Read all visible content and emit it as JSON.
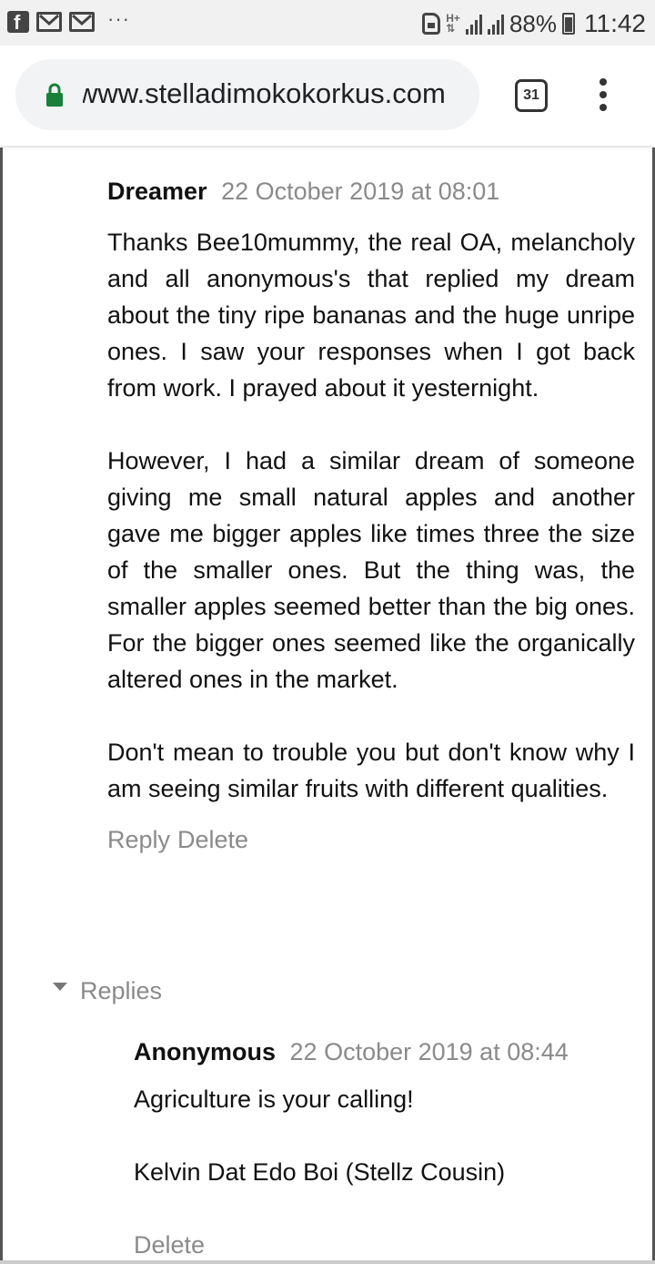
{
  "status_bar": {
    "network_type": "H+",
    "battery_percent": "88%",
    "time": "11:42"
  },
  "browser": {
    "url": "www.stelladimokokorkus.com",
    "tab_count": "31"
  },
  "comment": {
    "author": "Dreamer",
    "date": "22 October 2019 at 08:01",
    "paragraphs": [
      "Thanks Bee10mummy, the real OA, melancholy and all anonymous's that replied my dream about the tiny ripe bananas and the huge unripe ones. I saw your responses when I got back from work. I prayed about it yesternight.",
      "However, I had a similar dream of someone giving me small natural apples and another gave me bigger apples like times three the size of the smaller ones. But the thing was, the smaller apples seemed better than the big ones. For the bigger ones seemed like the organically altered ones in the market.",
      "Don't mean to trouble you but don't know why I am seeing similar fruits with different qualities."
    ],
    "reply_label": "Reply",
    "delete_label": "Delete"
  },
  "replies_toggle": "Replies",
  "reply": {
    "author": "Anonymous",
    "date": "22 October 2019 at 08:44",
    "paragraphs": [
      "Agriculture is your calling!",
      "Kelvin Dat Edo Boi (Stellz Cousin)"
    ],
    "delete_label": "Delete"
  }
}
